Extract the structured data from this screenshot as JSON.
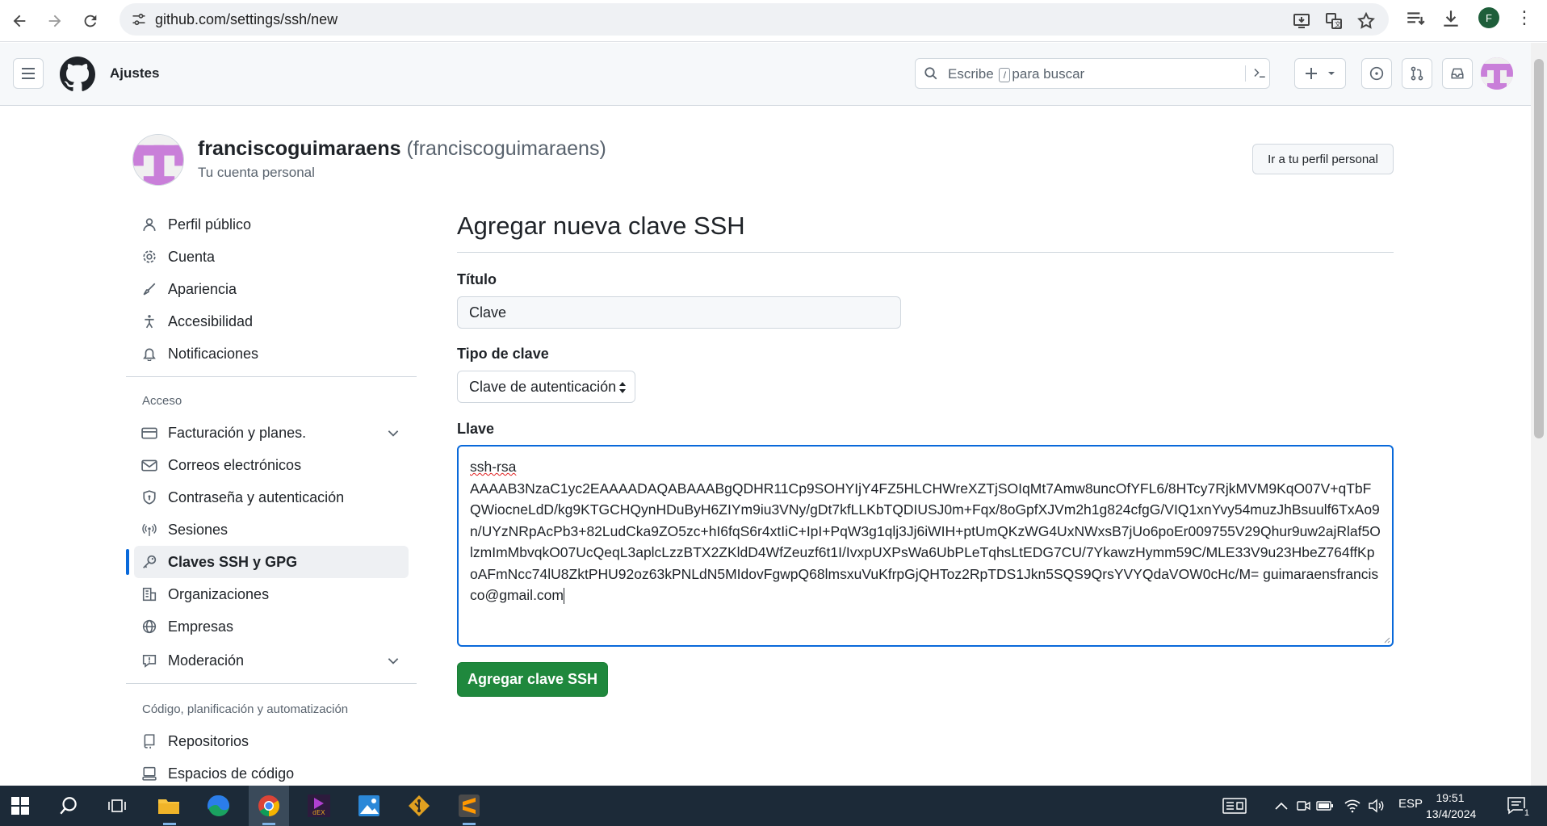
{
  "browser": {
    "url": "github.com/settings/ssh/new"
  },
  "header": {
    "context_title": "Ajustes",
    "search_placeholder_before": "Escribe",
    "search_slash": "/",
    "search_placeholder_after": "para buscar"
  },
  "account": {
    "name": "franciscoguimaraens",
    "login": "(franciscoguimaraens)",
    "subtitle": "Tu cuenta personal",
    "profile_button": "Ir a tu perfil personal"
  },
  "sidebar": {
    "items_top": [
      {
        "label": "Perfil público",
        "icon": "person-icon"
      },
      {
        "label": "Cuenta",
        "icon": "gear-icon"
      },
      {
        "label": "Apariencia",
        "icon": "paintbrush-icon"
      },
      {
        "label": "Accesibilidad",
        "icon": "accessibility-icon"
      },
      {
        "label": "Notificaciones",
        "icon": "bell-icon"
      }
    ],
    "access_heading": "Acceso",
    "items_access": [
      {
        "label": "Facturación y planes.",
        "icon": "credit-card-icon"
      },
      {
        "label": "Correos electrónicos",
        "icon": "mail-icon"
      },
      {
        "label": "Contraseña y autenticación",
        "icon": "shield-lock-icon"
      },
      {
        "label": "Sesiones",
        "icon": "broadcast-icon"
      },
      {
        "label": "Claves SSH y GPG",
        "icon": "key-icon"
      },
      {
        "label": "Organizaciones",
        "icon": "organization-icon"
      },
      {
        "label": "Empresas",
        "icon": "globe-icon"
      },
      {
        "label": "Moderación",
        "icon": "report-icon"
      }
    ],
    "code_heading": "Código, planificación y automatización",
    "items_code": [
      {
        "label": "Repositorios",
        "icon": "repo-icon"
      },
      {
        "label": "Espacios de código",
        "icon": "codespaces-icon"
      }
    ]
  },
  "main": {
    "title": "Agregar nueva clave SSH",
    "title_label": "Título",
    "title_value": "Clave",
    "key_type_label": "Tipo de clave",
    "key_type_value": "Clave de autenticación",
    "key_label": "Llave",
    "key_prefix": "ssh-rsa",
    "key_body": "AAAAB3NzaC1yc2EAAAADAQABAAABgQDHR11Cp9SOHYIjY4FZ5HLCHWreXZTjSOIqMt7Amw8uncOfYFL6/8HTcy7RjkMVM9KqO07V+qTbFQWiocneLdD/kg9KTGCHQynHDuByH6ZIYm9iu3VNy/gDt7kfLLKbTQDIUSJ0m+Fqx/8oGpfXJVm2h1g824cfgG/VIQ1xnYvy54muzJhBsuulf6TxAo9n/UYzNRpAcPb3+82LudCka9ZO5zc+hI6fqS6r4xtIiC+IpI+PqW3g1qlj3Jj6iWIH+ptUmQKzWG4UxNWxsB7jUo6poEr009755V29Qhur9uw2ajRlaf5OlzmImMbvqkO07UcQeqL3aplcLzzBTX2ZKldD4WfZeuzf6t1I/IvxpUXPsWa6UbPLeTqhsLtEDG7CU/7YkawzHymm59C/MLE33V9u23HbeZ764ffKpoAFmNcc74lU8ZktPHU92oz63kPNLdN5MIdovFgwpQ68lmsxuVuKfrpGjQHToz2RpTDS1Jkn5SQS9QrsYVYQdaVOW0cHc/M= guimaraensfrancisco@gmail.com",
    "submit_label": "Agregar clave SSH"
  },
  "taskbar": {
    "language": "ESP",
    "time": "19:51",
    "date": "13/4/2024",
    "notification_count": "1"
  }
}
